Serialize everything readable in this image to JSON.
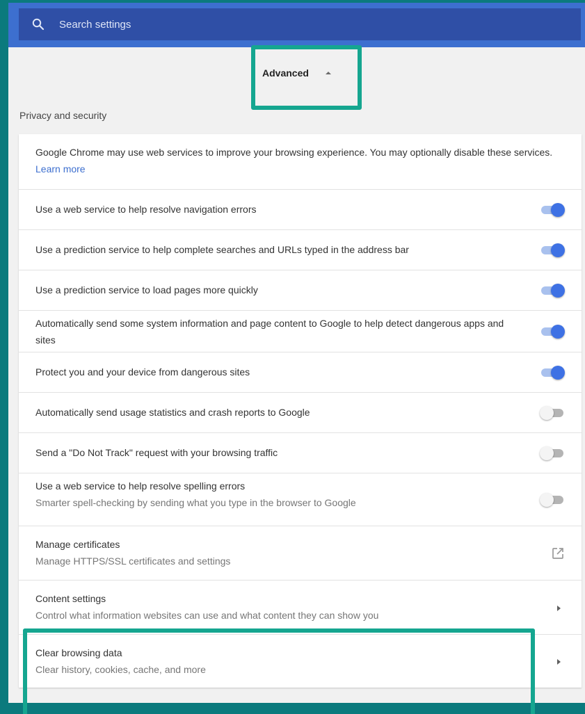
{
  "search": {
    "placeholder": "Search settings"
  },
  "advanced": {
    "label": "Advanced"
  },
  "section": {
    "title": "Privacy and security"
  },
  "intro": {
    "text": "Google Chrome may use web services to improve your browsing experience. You may optionally disable these services.",
    "link": "Learn more"
  },
  "toggles": [
    {
      "label": "Use a web service to help resolve navigation errors",
      "sub": "",
      "on": true
    },
    {
      "label": "Use a prediction service to help complete searches and URLs typed in the address bar",
      "sub": "",
      "on": true
    },
    {
      "label": "Use a prediction service to load pages more quickly",
      "sub": "",
      "on": true
    },
    {
      "label": "Automatically send some system information and page content to Google to help detect dangerous apps and sites",
      "sub": "",
      "on": true
    },
    {
      "label": "Protect you and your device from dangerous sites",
      "sub": "",
      "on": true
    },
    {
      "label": "Automatically send usage statistics and crash reports to Google",
      "sub": "",
      "on": false
    },
    {
      "label": "Send a \"Do Not Track\" request with your browsing traffic",
      "sub": "",
      "on": false
    },
    {
      "label": "Use a web service to help resolve spelling errors",
      "sub": "Smarter spell-checking by sending what you type in the browser to Google",
      "on": false
    }
  ],
  "certificates": {
    "label": "Manage certificates",
    "sub": "Manage HTTPS/SSL certificates and settings"
  },
  "content_settings": {
    "label": "Content settings",
    "sub": "Control what information websites can use and what content they can show you"
  },
  "clear_data": {
    "label": "Clear browsing data",
    "sub": "Clear history, cookies, cache, and more"
  },
  "colors": {
    "accent": "#3e71e4",
    "highlight": "#15a690",
    "header": "#3d6fcf"
  }
}
